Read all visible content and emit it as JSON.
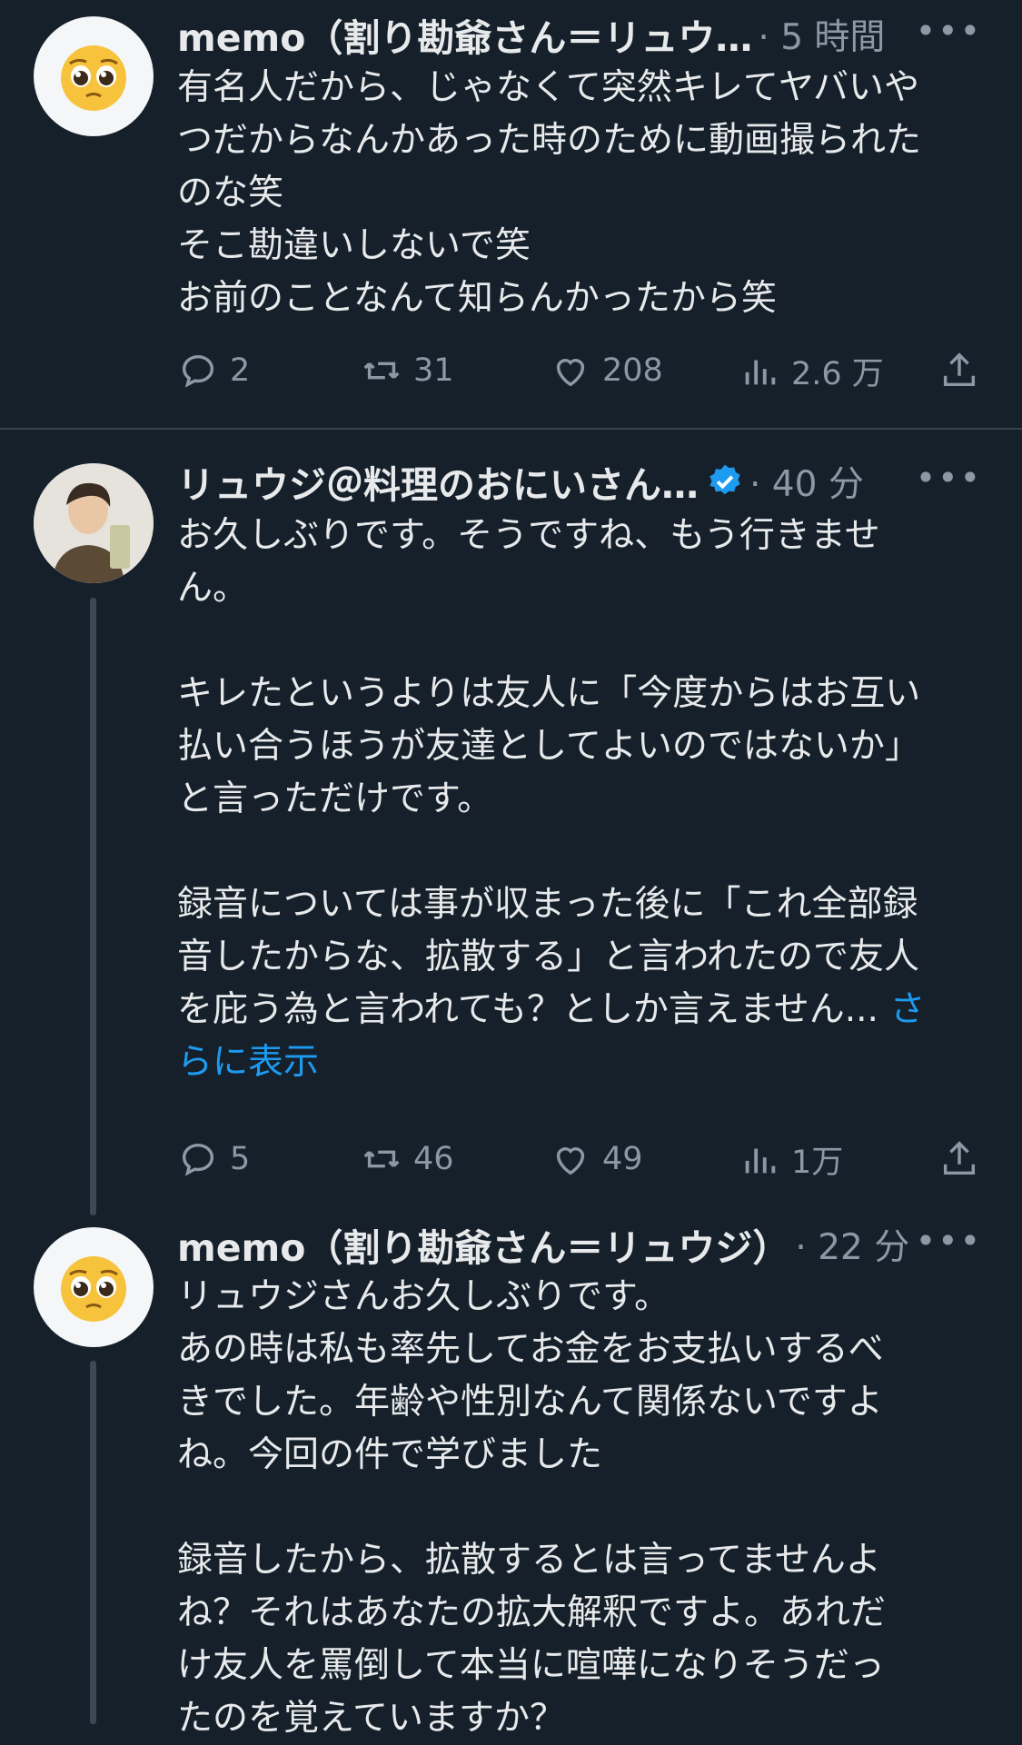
{
  "tweets": [
    {
      "name": "memo（割り勘爺さん＝リュウ…",
      "time": "· 5 時間",
      "more": "•••",
      "body": "有名人だから、じゃなくて突然キレてヤバいや\nつだからなんかあった時のために動画撮られた\nのな笑\nそこ勘違いしないで笑\nお前のことなんて知らんかったから笑",
      "replies": "2",
      "reposts": "31",
      "likes": "208",
      "views": "2.6 万"
    },
    {
      "name": "リュウジ＠料理のおにいさん…",
      "time": "· 40 分",
      "more": "•••",
      "body": "お久しぶりです。そうですね、もう行きませ\nん。\n\nキレたというよりは友人に「今度からはお互い\n払い合うほうが友達としてよいのではないか」\nと言っただけです。\n\n録音については事が収まった後に「これ全部録\n音したからな、拡散する」と言われたので友人\nを庇う為と言われても？としか言えません... ",
      "show_more": "さ\nらに表示",
      "replies": "5",
      "reposts": "46",
      "likes": "49",
      "views": "1万"
    },
    {
      "name": "memo（割り勘爺さん＝リュウジ）",
      "time": "· 22 分",
      "more": "•••",
      "body": "リュウジさんお久しぶりです。\nあの時は私も率先してお金をお支払いするべ\nきでした。年齢や性別なんて関係ないですよ\nね。今回の件で学びました\n\n録音したから、拡散するとは言ってませんよ\nね？それはあなたの拡大解釈ですよ。あれだ\nけ友人を罵倒して本当に喧嘩になりそうだっ\nたのを覚えていますか？"
    }
  ],
  "colors": {
    "background": "#15202b",
    "text": "#e7e9ea",
    "muted": "#8b98a5",
    "accent": "#1d9bf0"
  }
}
